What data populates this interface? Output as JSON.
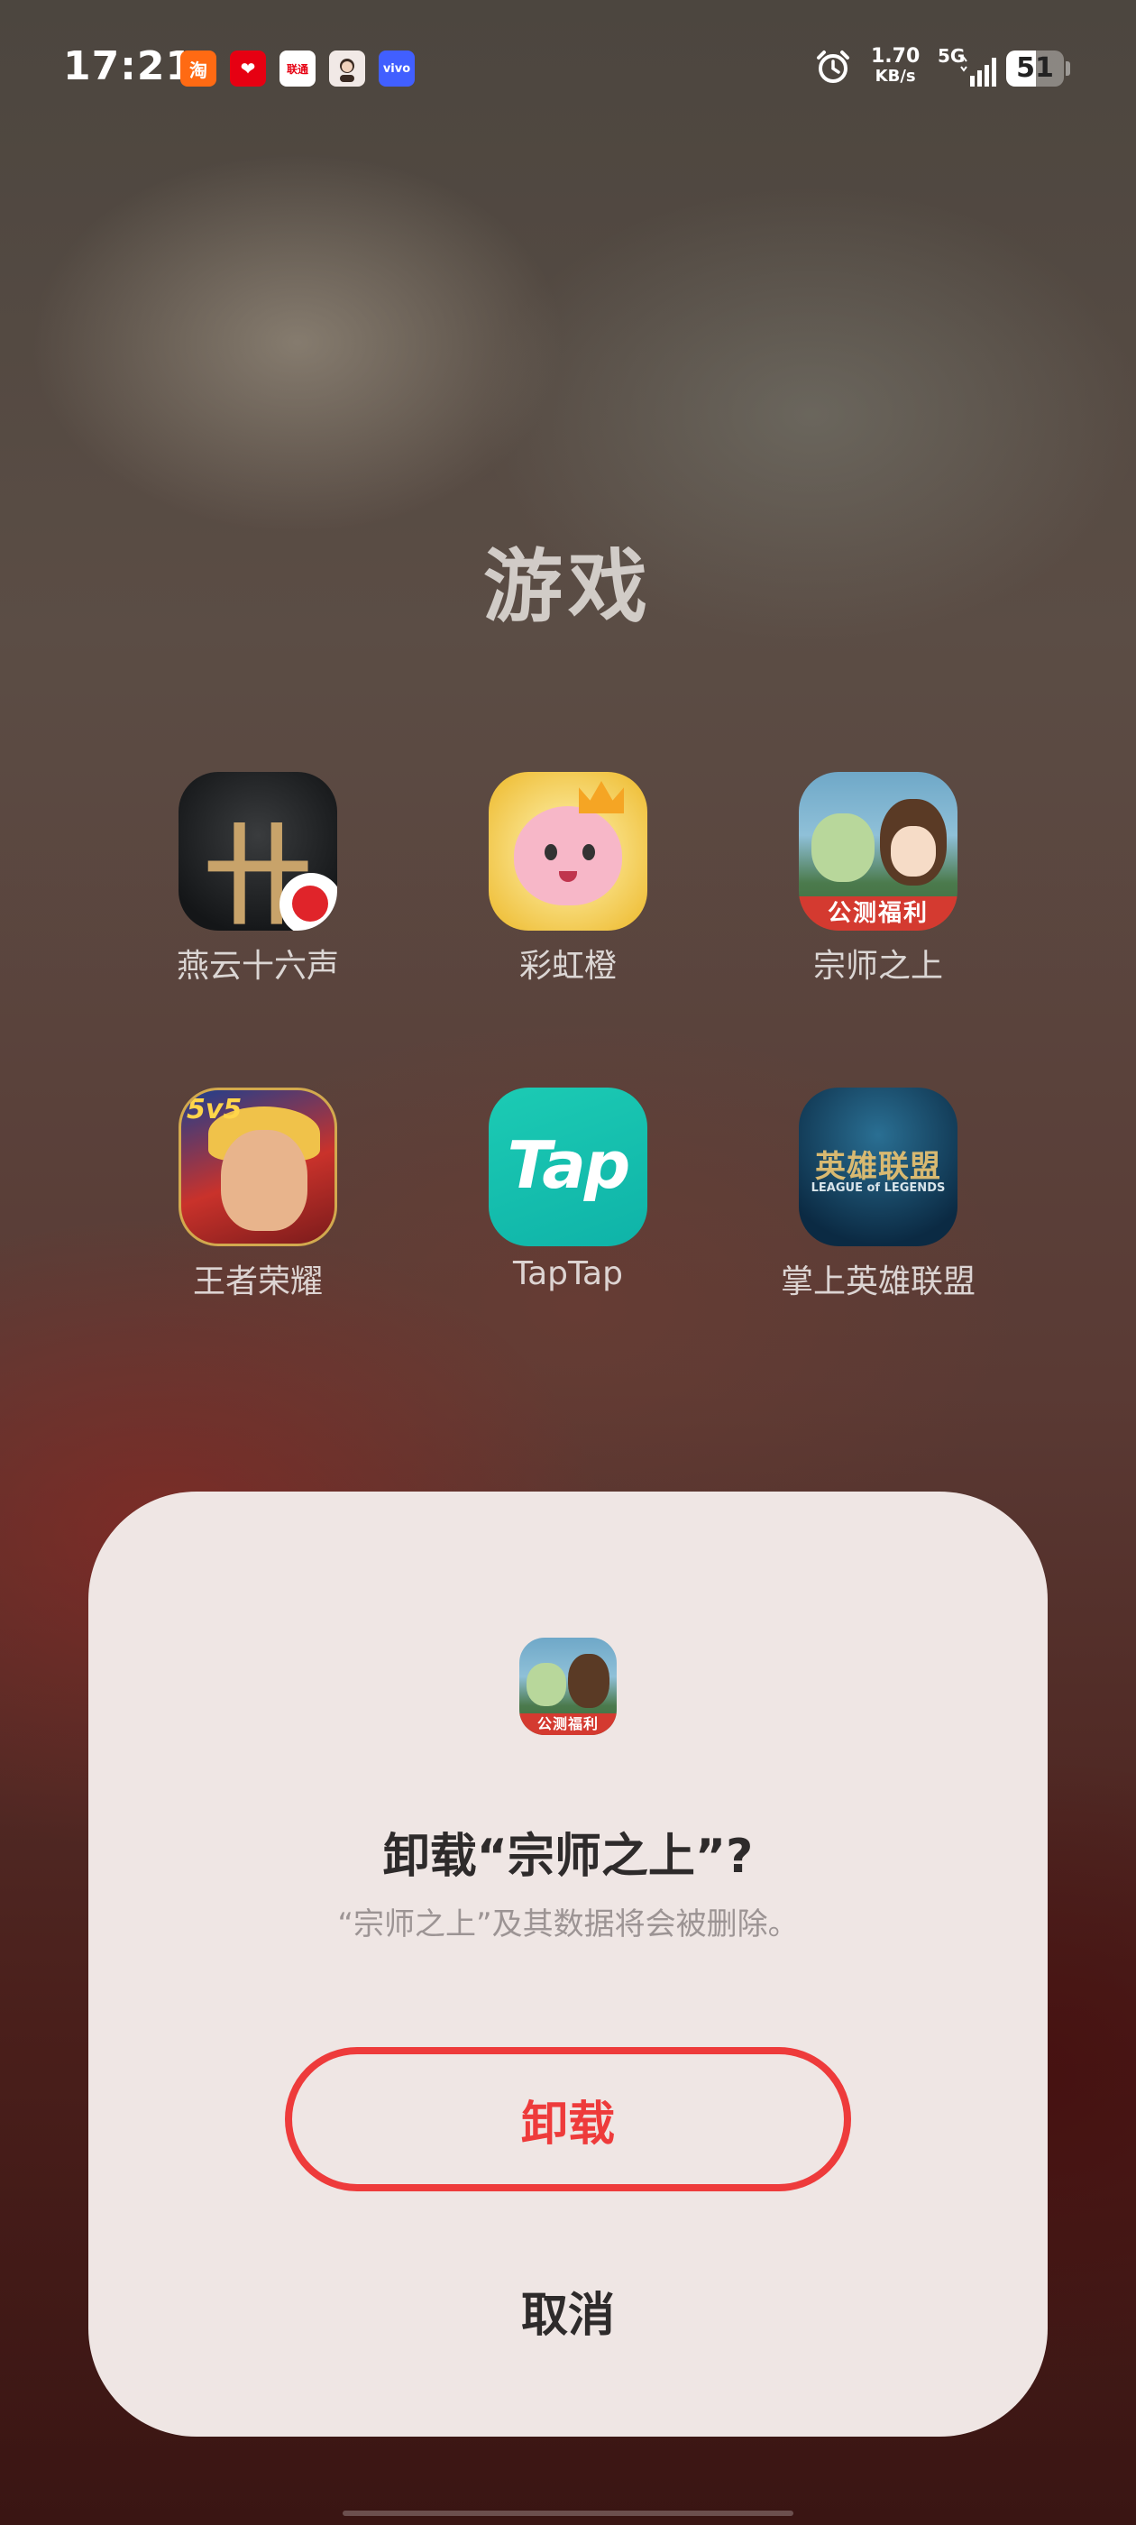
{
  "status_bar": {
    "time": "17:21",
    "notifications": [
      "淘",
      "❤",
      "联通",
      "",
      "vivo"
    ],
    "speed_value": "1.70",
    "speed_unit": "KB/s",
    "network": "5G",
    "battery": "51",
    "battery_level": 0.51
  },
  "folder": {
    "title": "游戏",
    "apps": [
      {
        "label": "燕云十六声",
        "icon": "yanyun-icon"
      },
      {
        "label": "彩虹橙",
        "icon": "caihong-icon"
      },
      {
        "label": "宗师之上",
        "icon": "zongshi-icon",
        "ribbon": "公测福利"
      },
      {
        "label": "王者荣耀",
        "icon": "wangzhe-icon",
        "tag": "5v5"
      },
      {
        "label": "TapTap",
        "icon": "taptap-icon",
        "word": "Tap"
      },
      {
        "label": "掌上英雄联盟",
        "icon": "lol-icon",
        "cn": "英雄联盟",
        "en": "LEAGUE of LEGENDS"
      }
    ]
  },
  "dialog": {
    "title": "卸载“宗师之上”?",
    "description": "“宗师之上”及其数据将会被删除。",
    "ribbon": "公测福利",
    "uninstall_label": "卸载",
    "cancel_label": "取消"
  },
  "colors": {
    "accent_red": "#ee3b3b",
    "sheet_bg": "#efe6e4"
  }
}
